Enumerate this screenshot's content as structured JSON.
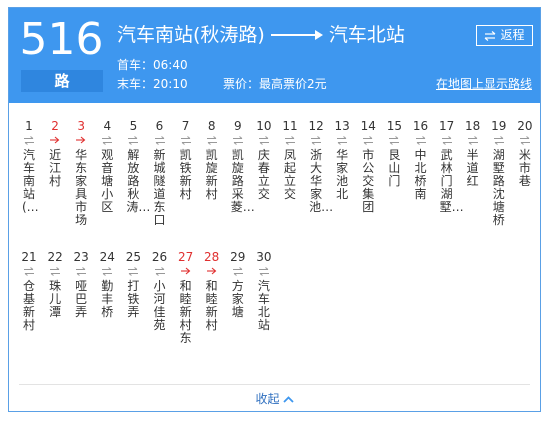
{
  "route": {
    "number": "516",
    "unit": "路",
    "from": "汽车南站(秋涛路)",
    "to": "汽车北站",
    "first_bus": "首车：06:40",
    "last_bus": "末车：20:10",
    "price": "票价：最高票价2元",
    "map_link": "在地图上显示路线",
    "return_button": "返程",
    "accent_color": "#3e97ef",
    "highlight_color": "#e03030"
  },
  "stops": [
    {
      "idx": "1",
      "name": "汽车南站(…",
      "highlight": false
    },
    {
      "idx": "2",
      "name": "近江村",
      "highlight": true
    },
    {
      "idx": "3",
      "name": "华东家具市场",
      "highlight": true
    },
    {
      "idx": "4",
      "name": "观音塘小区",
      "highlight": false
    },
    {
      "idx": "5",
      "name": "解放路秋涛…",
      "highlight": false
    },
    {
      "idx": "6",
      "name": "新城隧道东口",
      "highlight": false
    },
    {
      "idx": "7",
      "name": "凯铁新村",
      "highlight": false
    },
    {
      "idx": "8",
      "name": "凯旋新村",
      "highlight": false
    },
    {
      "idx": "9",
      "name": "凯旋路采菱…",
      "highlight": false
    },
    {
      "idx": "10",
      "name": "庆春立交",
      "highlight": false
    },
    {
      "idx": "11",
      "name": "凤起立交",
      "highlight": false
    },
    {
      "idx": "12",
      "name": "浙大华家池…",
      "highlight": false
    },
    {
      "idx": "13",
      "name": "华家池北",
      "highlight": false
    },
    {
      "idx": "14",
      "name": "市公交集团",
      "highlight": false
    },
    {
      "idx": "15",
      "name": "艮山门",
      "highlight": false
    },
    {
      "idx": "16",
      "name": "中北桥南",
      "highlight": false
    },
    {
      "idx": "17",
      "name": "武林门湖墅…",
      "highlight": false
    },
    {
      "idx": "18",
      "name": "半道红",
      "highlight": false
    },
    {
      "idx": "19",
      "name": "湖墅路沈塘桥",
      "highlight": false
    },
    {
      "idx": "20",
      "name": "米市巷",
      "highlight": false
    },
    {
      "idx": "21",
      "name": "仓基新村",
      "highlight": false
    },
    {
      "idx": "22",
      "name": "珠儿潭",
      "highlight": false
    },
    {
      "idx": "23",
      "name": "哑巴弄",
      "highlight": false
    },
    {
      "idx": "24",
      "name": "勤丰桥",
      "highlight": false
    },
    {
      "idx": "25",
      "name": "打铁弄",
      "highlight": false
    },
    {
      "idx": "26",
      "name": "小河佳苑",
      "highlight": false
    },
    {
      "idx": "27",
      "name": "和睦新村东",
      "highlight": true
    },
    {
      "idx": "28",
      "name": "和睦新村",
      "highlight": true
    },
    {
      "idx": "29",
      "name": "方家塘",
      "highlight": false
    },
    {
      "idx": "30",
      "name": "汽车北站",
      "highlight": false
    }
  ],
  "footer": {
    "collapse_label": "收起"
  }
}
